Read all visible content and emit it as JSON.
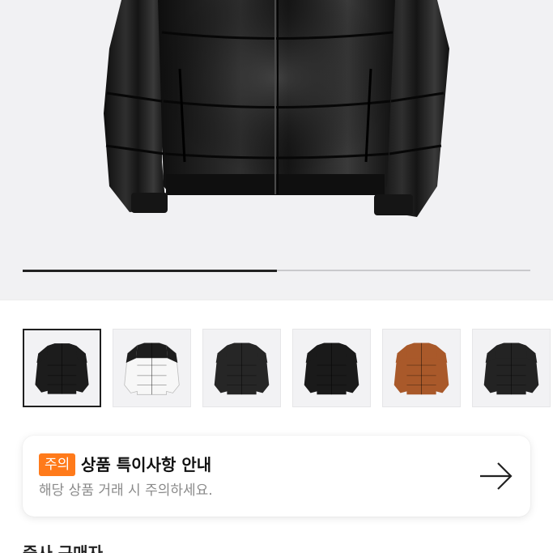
{
  "gallery": {
    "progress_fraction": 0.5,
    "thumbnails": [
      {
        "name": "thumb-black-jacket-front",
        "color": "#1c1c1c",
        "selected": true
      },
      {
        "name": "thumb-white-jacket",
        "color": "#f4f4f4",
        "selected": false
      },
      {
        "name": "thumb-black-matte-jacket",
        "color": "#262626",
        "selected": false
      },
      {
        "name": "thumb-black-jacket",
        "color": "#1a1a1a",
        "selected": false
      },
      {
        "name": "thumb-brown-jacket",
        "color": "#a9592a",
        "selected": false
      },
      {
        "name": "thumb-black-jacket-alt",
        "color": "#232323",
        "selected": false
      }
    ]
  },
  "notice": {
    "badge": "주의",
    "title": "상품 특이사항 안내",
    "subtitle": "해당 상품 거래 시 주의하세요.",
    "badge_color": "#ff7a1a",
    "arrow_icon": "arrow-right-icon"
  },
  "seller": {
    "label": "중사 구매자"
  }
}
